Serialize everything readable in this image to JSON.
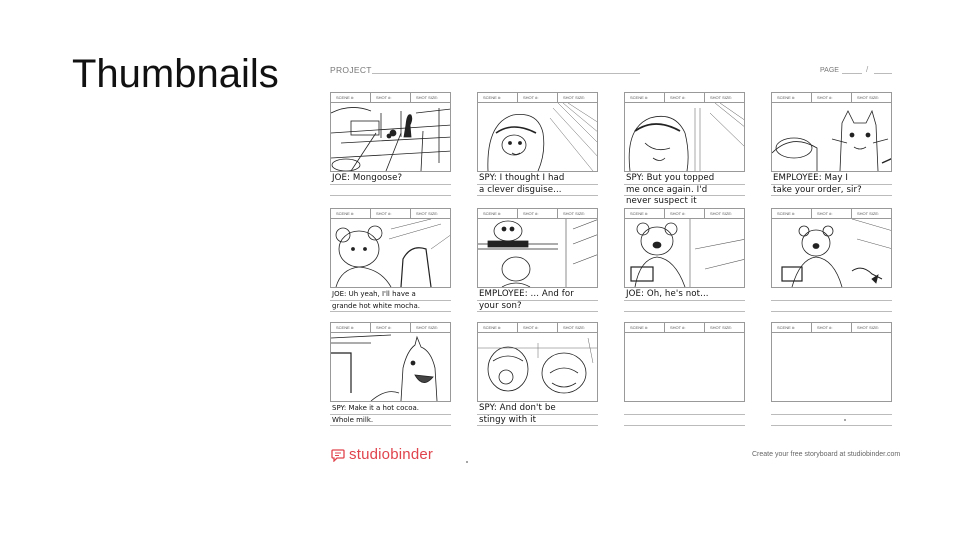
{
  "slide": {
    "title": "Thumbnails"
  },
  "sheet": {
    "project_label": "PROJECT",
    "page_label": "PAGE",
    "page_separator": "/",
    "header_labels": {
      "scene": "SCENE #:",
      "shot": "SHOT #:",
      "shot_size": "SHOT SIZE:"
    }
  },
  "panels": [
    {
      "caption": "JOE: Mongoose?",
      "sketch": "living-room"
    },
    {
      "caption": "SPY: I thought I had\na clever disguise...",
      "sketch": "hooded-face"
    },
    {
      "caption": "SPY: But you topped\nme once again. I'd\nnever suspect it",
      "sketch": "hooded-profile"
    },
    {
      "caption": "EMPLOYEE: May I\ntake your order, sir?",
      "sketch": "cat-employee"
    },
    {
      "caption": "JOE: Uh yeah, I'll have a\ngrande hot white mocha.",
      "sketch": "joe-ordering"
    },
    {
      "caption": "EMPLOYEE: ... And for\nyour son?",
      "sketch": "counter-view"
    },
    {
      "caption": "JOE: Oh, he's not...",
      "sketch": "joe-register"
    },
    {
      "caption": "",
      "sketch": "joe-register-2"
    },
    {
      "caption": "SPY: Make it a hot cocoa.\nWhole milk.",
      "sketch": "spy-laughing"
    },
    {
      "caption": "SPY: And don't be\nstingy with it",
      "sketch": "two-faces"
    },
    {
      "caption": "",
      "sketch": "empty"
    },
    {
      "caption": "",
      "sketch": "empty"
    }
  ],
  "footer": {
    "brand_name": "studiobinder",
    "brand_icon": "chat-bubble-icon",
    "brand_color": "#e0444d",
    "tagline": "Create your free storyboard at studiobinder.com"
  }
}
